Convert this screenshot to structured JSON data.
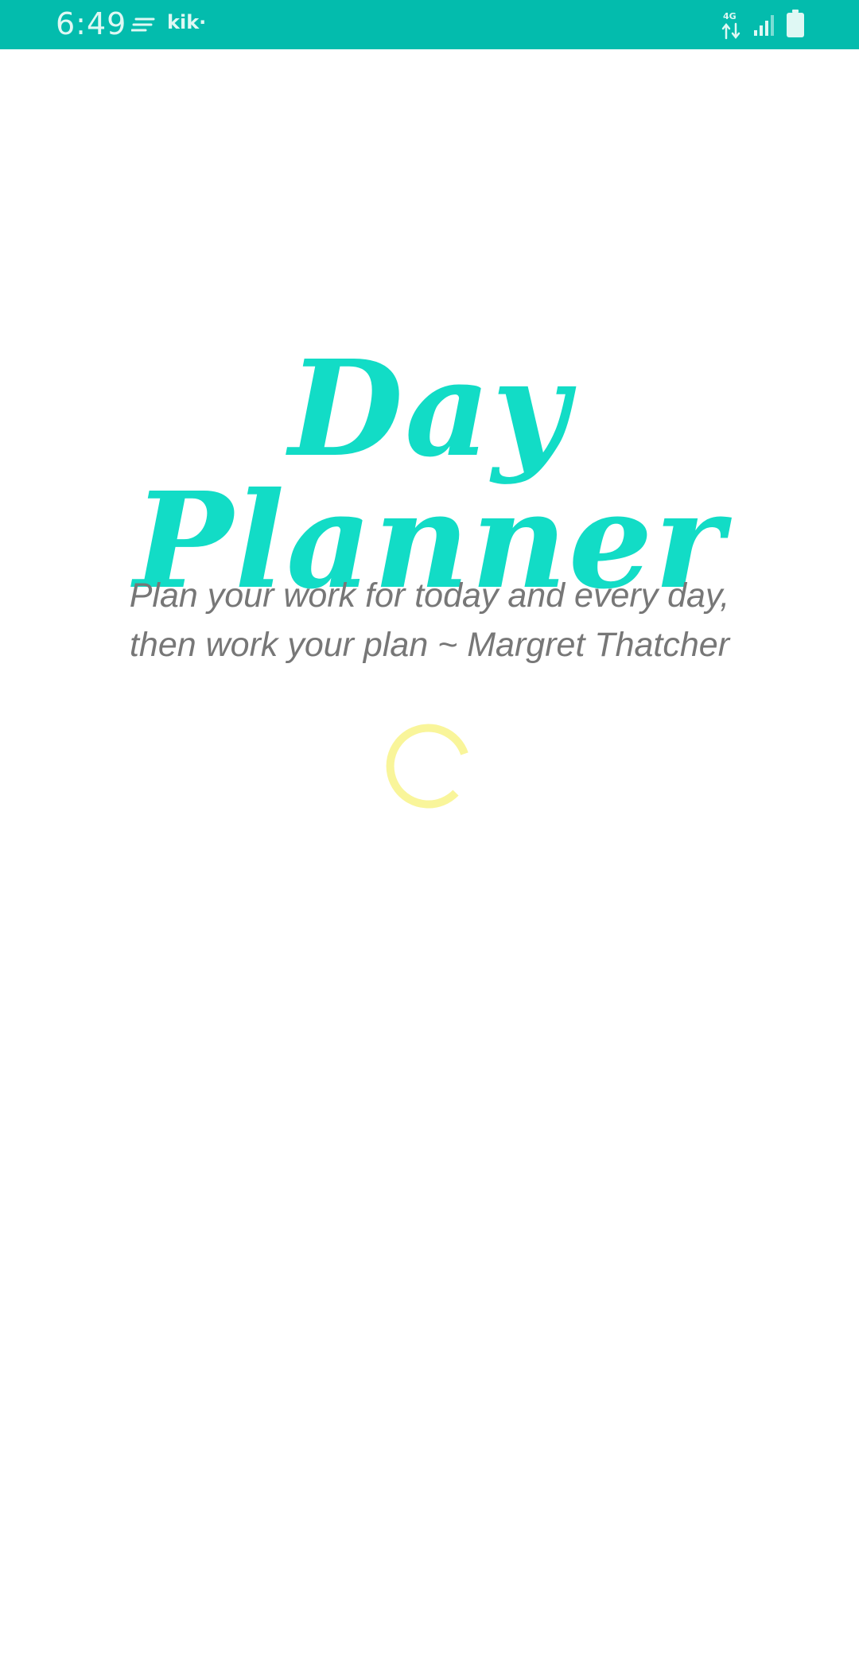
{
  "status_bar": {
    "time": "6:49",
    "kik_label": "kik·",
    "network_label": "4G",
    "bg_color": "#03bcad",
    "icons": [
      "notification-lines-icon",
      "kik-icon",
      "mobile-data-4g-icon",
      "signal-strength-icon",
      "battery-icon"
    ]
  },
  "splash": {
    "title": "Day Planner",
    "title_color": "#12dcc6",
    "quote_line1": "Plan your work for today and every day,",
    "quote_line2": "then work your plan ~ Margret Thatcher",
    "quote_color": "#777777",
    "spinner_color": "#f9f59a",
    "spinner_icon": "loading-spinner-icon"
  }
}
